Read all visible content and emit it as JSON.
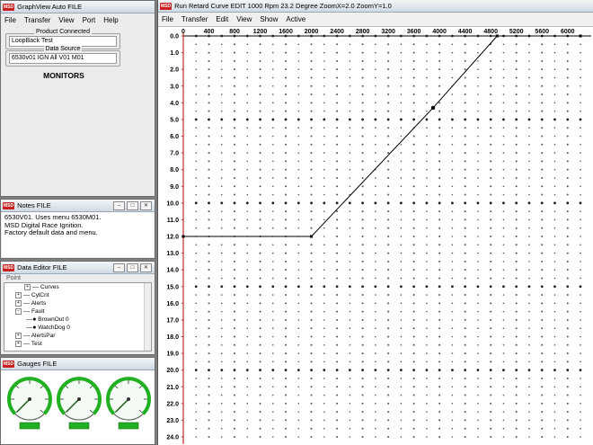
{
  "auto": {
    "title": "GraphView Auto FILE",
    "menu": [
      "File",
      "Transfer",
      "View",
      "Port",
      "Help"
    ],
    "product_label": "Product Connected",
    "product_value": "LoopBack Test",
    "source_label": "Data Source",
    "source_value": "6530v01 IGN All V01 M01",
    "monitors": "MONITORS"
  },
  "notes": {
    "title": "Notes  FILE",
    "lines": [
      "6530V01.  Uses menu 6530M01.",
      "MSD Digital Race Ignition.",
      "Factory default data and menu."
    ]
  },
  "editor": {
    "title": "Data Editor  FILE",
    "root": "Point",
    "items": [
      "Curves",
      "CylCnt",
      "Alerts",
      "Fault",
      "BrownOut  0",
      "WatchDog  0",
      "AlertsPar",
      "Test"
    ]
  },
  "gauges": {
    "title": "Gauges  FILE",
    "count": 3,
    "scale_values": [
      0,
      2,
      4,
      6,
      8,
      10,
      12
    ]
  },
  "graph": {
    "title": "Run Retard Curve   EDIT     1000 Rpm   23.2 Degree   ZoomX=2.0   ZoomY=1.0",
    "menu": [
      "File",
      "Transfer",
      "Edit",
      "View",
      "Show",
      "Active"
    ]
  },
  "colors": {
    "accent_red": "#c82020",
    "gauge_green": "#22b022",
    "curve": "#000000"
  },
  "chart_data": {
    "type": "line",
    "x_ticks": [
      0,
      400,
      800,
      1200,
      1600,
      2000,
      2400,
      2800,
      3200,
      3600,
      4000,
      4400,
      4800,
      5200,
      5600,
      6000
    ],
    "y_ticks": [
      "0.0",
      "1.0",
      "2.0",
      "3.0",
      "4.0",
      "5.0",
      "6.0",
      "7.0",
      "8.0",
      "9.0",
      "10.0",
      "11.0",
      "12.0",
      "13.0",
      "14.0",
      "15.0",
      "16.0",
      "17.0",
      "18.0",
      "19.0",
      "20.0",
      "21.0",
      "22.0",
      "23.0",
      "24.0"
    ],
    "xlim": [
      0,
      6200
    ],
    "ylim": [
      0,
      24
    ],
    "y_inverted": true,
    "grid": "dots",
    "series": [
      {
        "x": [
          0,
          2000,
          3900,
          4900,
          6200
        ],
        "y": [
          12,
          12,
          4.3,
          0,
          0
        ]
      }
    ],
    "markers": [
      {
        "x": 3900,
        "y": 4.3
      }
    ]
  }
}
